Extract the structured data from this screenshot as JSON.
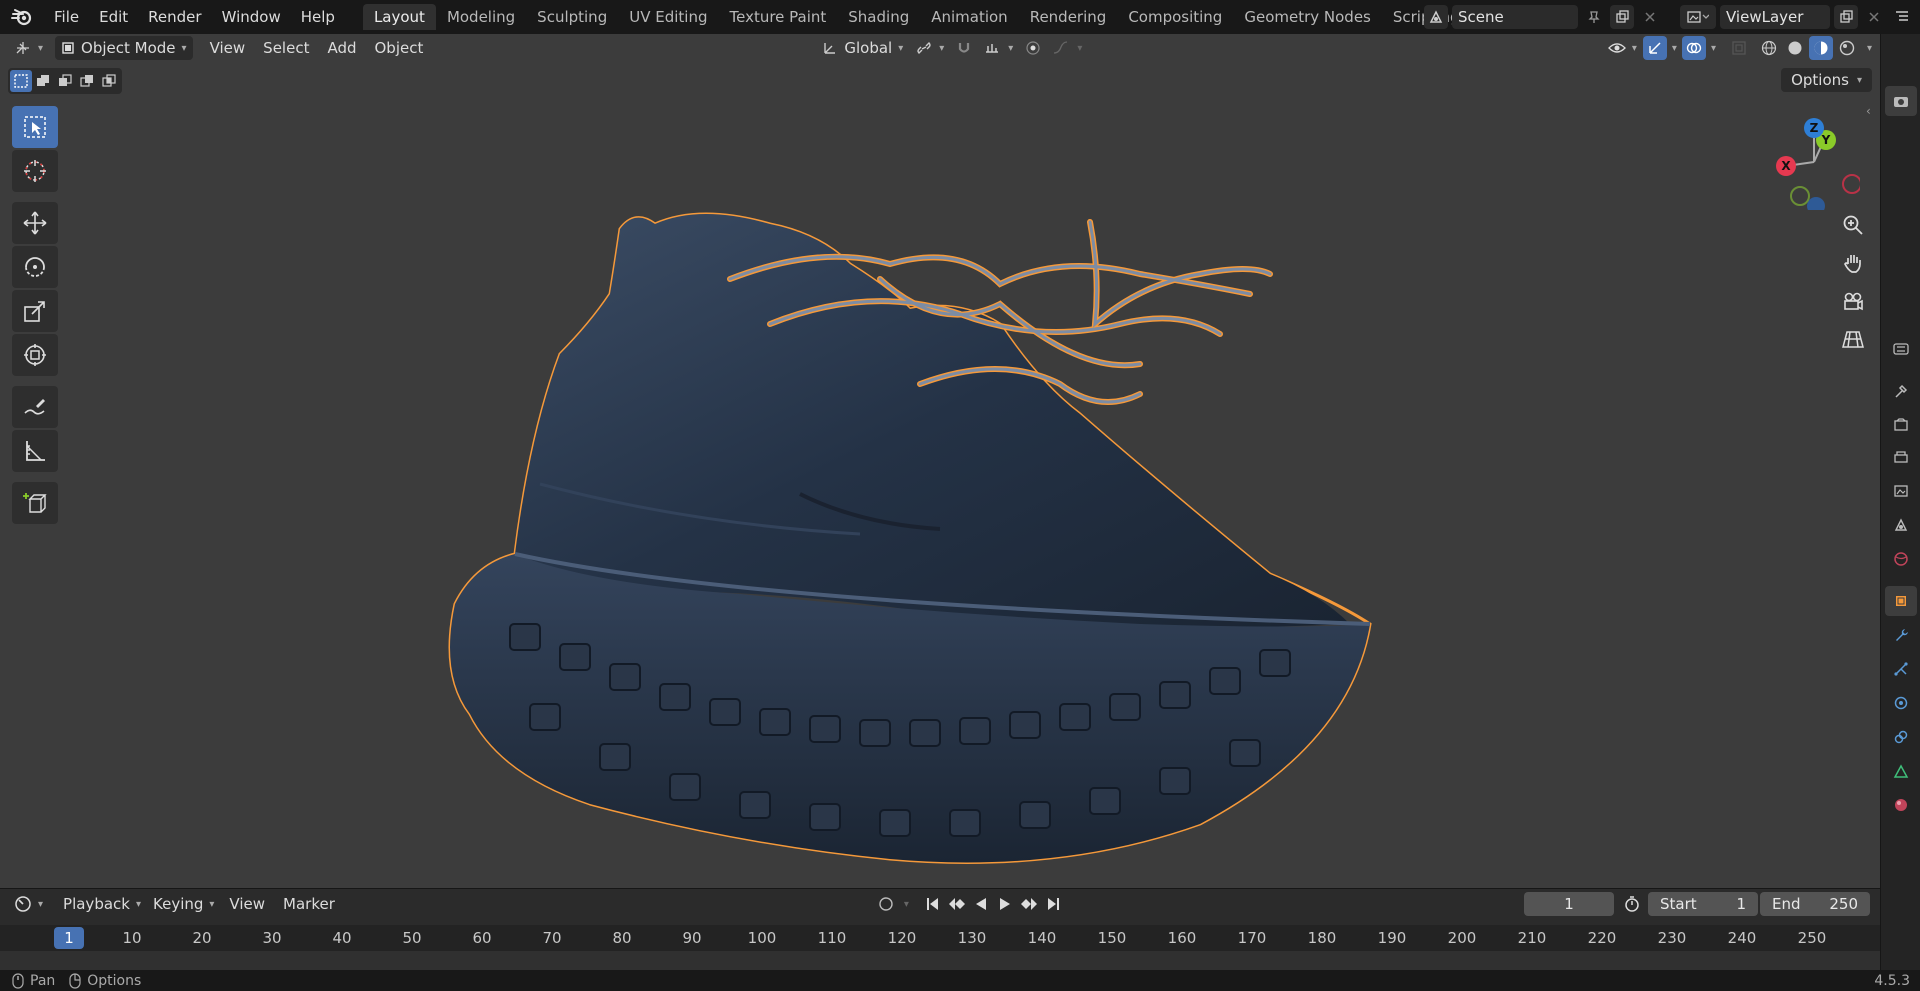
{
  "topbar": {
    "menus": [
      "File",
      "Edit",
      "Render",
      "Window",
      "Help"
    ],
    "tabs": [
      "Layout",
      "Modeling",
      "Sculpting",
      "UV Editing",
      "Texture Paint",
      "Shading",
      "Animation",
      "Rendering",
      "Compositing",
      "Geometry Nodes",
      "Scripting"
    ],
    "active_tab": "Layout",
    "add_tab": "+",
    "scene_name": "Scene",
    "viewlayer_name": "ViewLayer"
  },
  "viewport_header": {
    "mode": "Object Mode",
    "menus": [
      "View",
      "Select",
      "Add",
      "Object"
    ],
    "transform_orientation": "Global",
    "options_label": "Options"
  },
  "gizmo": {
    "x_label": "X",
    "y_label": "Y",
    "z_label": "Z"
  },
  "timeline": {
    "menus": [
      "Playback",
      "Keying",
      "View",
      "Marker"
    ],
    "current_frame": "1",
    "start_label": "Start",
    "start_value": "1",
    "end_label": "End",
    "end_value": "250",
    "ticks": [
      "1",
      "10",
      "20",
      "30",
      "40",
      "50",
      "60",
      "70",
      "80",
      "90",
      "100",
      "110",
      "120",
      "130",
      "140",
      "150",
      "160",
      "170",
      "180",
      "190",
      "200",
      "210",
      "220",
      "230",
      "240",
      "250"
    ]
  },
  "statusbar": {
    "pan_label": "Pan",
    "options_label": "Options",
    "version": "4.5.3"
  },
  "colors": {
    "accent": "#4772b3",
    "selection_outline": "#f5993a",
    "viewport_bg": "#3c3c3c",
    "axis_x": "#e63950",
    "axis_y": "#8acb29",
    "axis_z": "#2e7fd6"
  }
}
